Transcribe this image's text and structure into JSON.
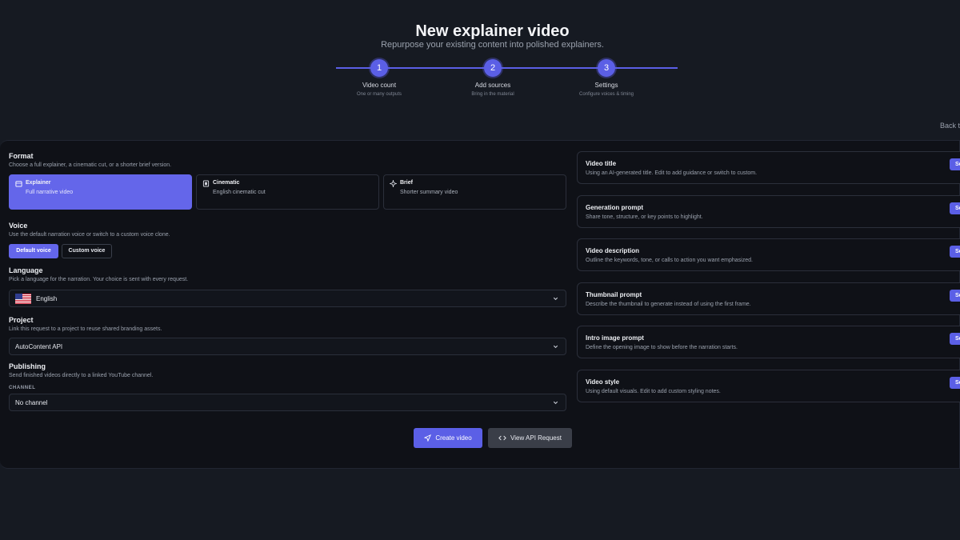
{
  "header": {
    "title": "New explainer video",
    "subtitle": "Repurpose your existing content into polished explainers.",
    "back_link": "Back to"
  },
  "stepper": {
    "steps": [
      {
        "number": "1",
        "title": "Video count",
        "subtitle": "One or many outputs"
      },
      {
        "number": "2",
        "title": "Add sources",
        "subtitle": "Bring in the material"
      },
      {
        "number": "3",
        "title": "Settings",
        "subtitle": "Configure voices & timing"
      }
    ]
  },
  "format": {
    "label": "Format",
    "hint": "Choose a full explainer, a cinematic cut, or a shorter brief version.",
    "options": [
      {
        "title": "Explainer",
        "subtitle": "Full narrative video",
        "icon": "video-icon",
        "selected": true
      },
      {
        "title": "Cinematic",
        "subtitle": "English cinematic cut",
        "icon": "film-icon",
        "selected": false
      },
      {
        "title": "Brief",
        "subtitle": "Shorter summary video",
        "icon": "sparkle-icon",
        "selected": false
      }
    ]
  },
  "voice": {
    "label": "Voice",
    "hint": "Use the default narration voice or switch to a custom voice clone.",
    "default_label": "Default voice",
    "custom_label": "Custom voice"
  },
  "language": {
    "label": "Language",
    "hint": "Pick a language for the narration. Your choice is sent with every request.",
    "value": "English"
  },
  "project": {
    "label": "Project",
    "hint": "Link this request to a project to reuse shared branding assets.",
    "value": "AutoContent API"
  },
  "publishing": {
    "label": "Publishing",
    "hint": "Send finished videos directly to a linked YouTube channel.",
    "channel_label": "CHANNEL",
    "value": "No channel"
  },
  "actions": {
    "create_label": "Create video",
    "api_label": "View API Request"
  },
  "settings": [
    {
      "title": "Video title",
      "subtitle": "Using an AI-generated title. Edit to add guidance or switch to custom.",
      "button": "Se"
    },
    {
      "title": "Generation prompt",
      "subtitle": "Share tone, structure, or key points to highlight.",
      "button": "Se"
    },
    {
      "title": "Video description",
      "subtitle": "Outline the keywords, tone, or calls to action you want emphasized.",
      "button": "Se"
    },
    {
      "title": "Thumbnail prompt",
      "subtitle": "Describe the thumbnail to generate instead of using the first frame.",
      "button": "Se"
    },
    {
      "title": "Intro image prompt",
      "subtitle": "Define the opening image to show before the narration starts.",
      "button": "Se"
    },
    {
      "title": "Video style",
      "subtitle": "Using default visuals. Edit to add custom styling notes.",
      "button": "Se"
    }
  ],
  "colors": {
    "accent": "#5b5fe6",
    "background": "#161a22",
    "panel": "#0f1117"
  }
}
